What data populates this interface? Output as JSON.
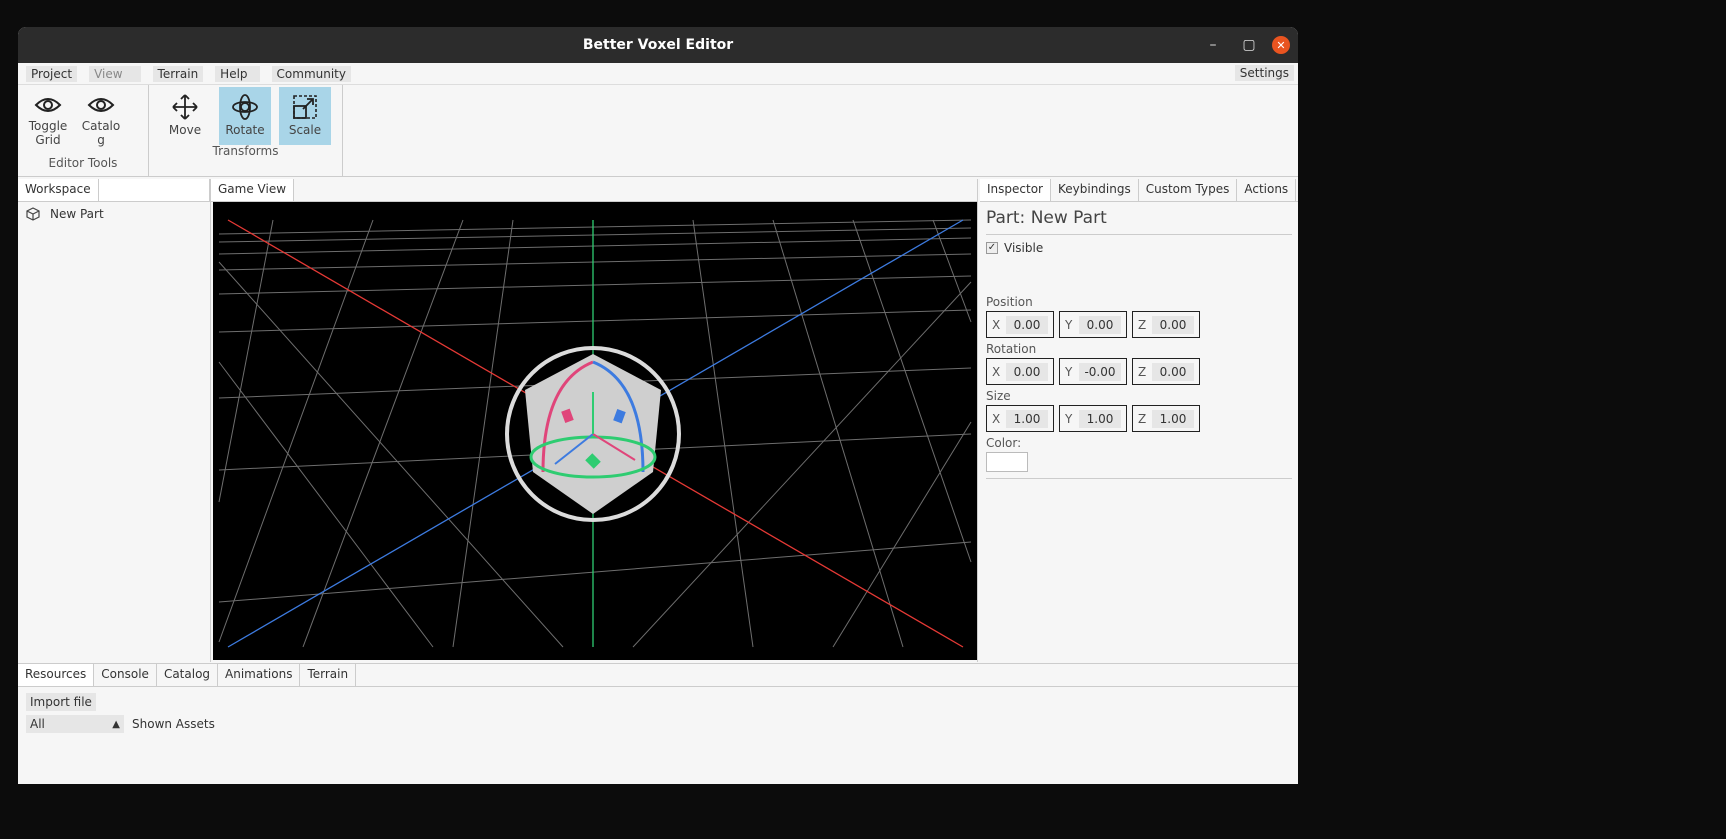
{
  "window": {
    "title": "Better Voxel Editor"
  },
  "menu": {
    "items": [
      "Project",
      "View",
      "Terrain",
      "Help",
      "Community"
    ],
    "settings": "Settings"
  },
  "ribbon": {
    "editor_tools": {
      "label": "Editor Tools",
      "toggle_grid": "Toggle Grid",
      "catalog": "Catalo g"
    },
    "transforms": {
      "label": "Transforms",
      "move": "Move",
      "rotate": "Rotate",
      "scale": "Scale"
    }
  },
  "workspace": {
    "tab": "Workspace",
    "items": [
      "New Part"
    ]
  },
  "game_view": {
    "tab": "Game View"
  },
  "right_tabs": [
    "Inspector",
    "Keybindings",
    "Custom Types",
    "Actions"
  ],
  "inspector": {
    "title": "Part: New Part",
    "visible_label": "Visible",
    "visible_checked": true,
    "position_label": "Position",
    "rotation_label": "Rotation",
    "size_label": "Size",
    "color_label": "Color:",
    "position": {
      "x": "0.00",
      "y": "0.00",
      "z": "0.00"
    },
    "rotation": {
      "x": "0.00",
      "y": "-0.00",
      "z": "0.00"
    },
    "size": {
      "x": "1.00",
      "y": "1.00",
      "z": "1.00"
    },
    "axis": {
      "x": "X",
      "y": "Y",
      "z": "Z"
    },
    "color_value": "#ffffff"
  },
  "bottom": {
    "tabs": [
      "Resources",
      "Console",
      "Catalog",
      "Animations",
      "Terrain"
    ],
    "import_button": "Import file",
    "filter_value": "All",
    "shown_assets": "Shown Assets"
  }
}
